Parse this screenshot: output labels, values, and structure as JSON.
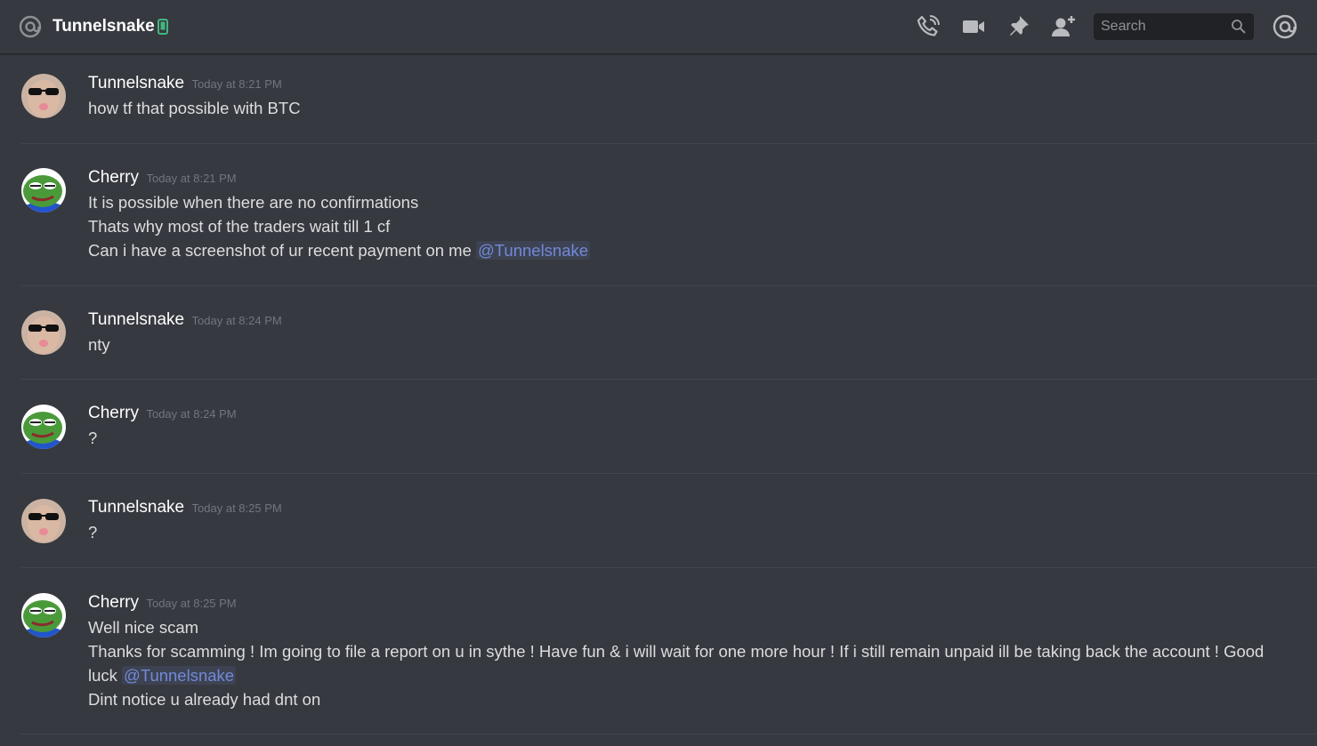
{
  "header": {
    "channel_name": "Tunnelsnake",
    "search_placeholder": "Search",
    "icons": [
      "at-icon",
      "mobile-icon",
      "voice-call-icon",
      "video-call-icon",
      "pin-icon",
      "add-friend-icon",
      "search-icon",
      "mentions-icon"
    ],
    "status_color": "#43b581"
  },
  "colors": {
    "background": "#36393f",
    "mention": "#7289da",
    "timestamp": "#72767d"
  },
  "messages": [
    {
      "author": "Tunnelsnake",
      "timestamp": "Today at 8:21 PM",
      "lines": [
        "how tf that possible with BTC"
      ]
    },
    {
      "author": "Cherry",
      "timestamp": "Today at 8:21 PM",
      "lines": [
        "It is possible when there are no confirmations",
        "Thats why most of the traders wait till 1 cf",
        "Can i have a screenshot of ur recent payment on me"
      ],
      "mention": "@Tunnelsnake"
    },
    {
      "author": "Tunnelsnake",
      "timestamp": "Today at 8:24 PM",
      "lines": [
        "nty"
      ]
    },
    {
      "author": "Cherry",
      "timestamp": "Today at 8:24 PM",
      "lines": [
        "?"
      ]
    },
    {
      "author": "Tunnelsnake",
      "timestamp": "Today at 8:25 PM",
      "lines": [
        "?"
      ]
    },
    {
      "author": "Cherry",
      "timestamp": "Today at 8:25 PM",
      "lines": [
        "Well nice scam",
        "Thanks for scamming ! Im going to file a report on u in sythe ! Have fun & i will wait for one more hour ! If i still remain unpaid ill be taking back the account ! Good",
        "luck",
        "Dint notice u already had dnt on"
      ],
      "mention": "@Tunnelsnake"
    }
  ]
}
